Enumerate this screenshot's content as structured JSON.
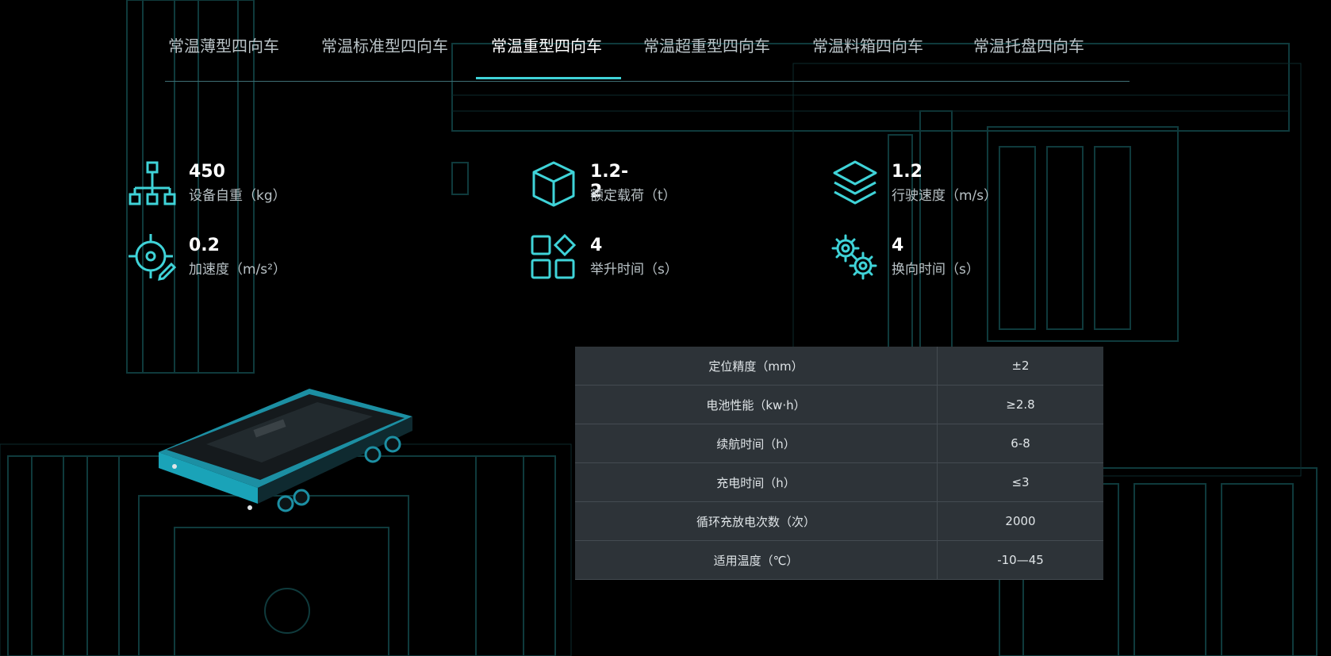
{
  "tabs": [
    {
      "label": "常温薄型四向车",
      "active": false
    },
    {
      "label": "常温标准型四向车",
      "active": false
    },
    {
      "label": "常温重型四向车",
      "active": true
    },
    {
      "label": "常温超重型四向车",
      "active": false
    },
    {
      "label": "常温料箱四向车",
      "active": false
    },
    {
      "label": "常温托盘四向车",
      "active": false
    }
  ],
  "stats": [
    {
      "value": "450",
      "label": "设备自重（kg）",
      "icon": "hierarchy-icon"
    },
    {
      "value": "1.2-2",
      "label": "额定载荷（t）",
      "icon": "box-icon"
    },
    {
      "value": "1.2",
      "label": "行驶速度（m/s）",
      "icon": "layers-icon"
    },
    {
      "value": "0.2",
      "label": "加速度（m/s²）",
      "icon": "target-icon"
    },
    {
      "value": "4",
      "label": "举升时间（s）",
      "icon": "apps-icon"
    },
    {
      "value": "4",
      "label": "换向时间（s）",
      "icon": "gears-icon"
    }
  ],
  "specs": [
    {
      "key": "定位精度（mm）",
      "value": "±2"
    },
    {
      "key": "电池性能（kw·h）",
      "value": "≥2.8"
    },
    {
      "key": "续航时间（h）",
      "value": "6-8"
    },
    {
      "key": "充电时间（h）",
      "value": "≤3"
    },
    {
      "key": "循环充放电次数（次）",
      "value": "2000"
    },
    {
      "key": "适用温度（℃）",
      "value": "-10—45"
    }
  ],
  "colors": {
    "accent": "#3fd3d8",
    "table_bg": "#2d3338",
    "text_muted": "#b9c2c6"
  }
}
